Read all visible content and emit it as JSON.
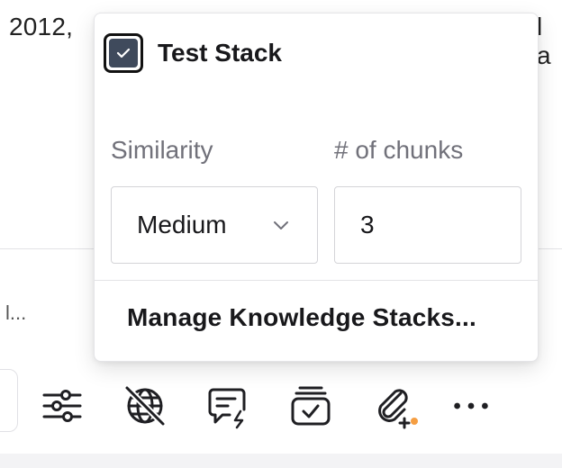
{
  "background": {
    "text_top_left": "2012,",
    "text_top_right": "l a",
    "truncated_text": "l..."
  },
  "popover": {
    "stack": {
      "label": "Test Stack",
      "checked": true
    },
    "similarity": {
      "label": "Similarity",
      "value": "Medium"
    },
    "chunks": {
      "label": "# of chunks",
      "value": "3"
    },
    "manage_link": "Manage Knowledge Stacks..."
  },
  "toolbar": {
    "buttons": [
      {
        "icon": "sliders-icon"
      },
      {
        "icon": "globe-off-icon"
      },
      {
        "icon": "chat-flash-icon"
      },
      {
        "icon": "stack-check-icon"
      },
      {
        "icon": "paperclip-plus-icon"
      },
      {
        "icon": "more-icon"
      }
    ]
  },
  "colors": {
    "text_primary": "#18181b",
    "label_muted": "#71717a",
    "border": "#d4d4d8",
    "checkbox_fill": "#3f4a5c",
    "badge_orange": "#f59e42"
  }
}
